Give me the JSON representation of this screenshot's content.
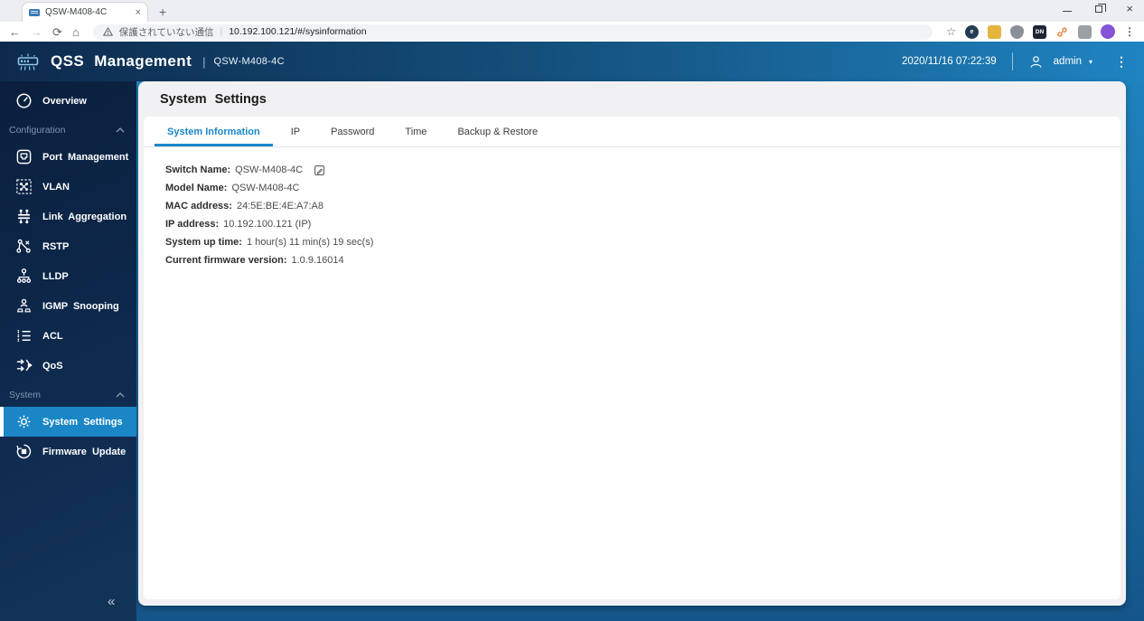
{
  "browser": {
    "tab_title": "QSW-M408-4C",
    "security_warning": "保護されていない通信",
    "url": "10.192.100.121/#/sysinformation",
    "icons": {
      "tab_close": "×",
      "new_tab": "+",
      "back": "←",
      "forward": "→",
      "reload": "⟳",
      "home": "⌂",
      "bookmark_star": "☆",
      "menu_dots": "⋮",
      "window_close": "×"
    },
    "extension_badges": {
      "first": "e",
      "fourth": "DN",
      "link": "🖇"
    }
  },
  "header": {
    "app_title": "QSS Management",
    "divider": "|",
    "device_name": "QSW-M408-4C",
    "datetime": "2020/11/16  07:22:39",
    "user": "admin",
    "user_caret": "▾",
    "menu_dots": "⋮"
  },
  "sidebar": {
    "sections": [
      {
        "label": "Configuration"
      },
      {
        "label": "System"
      }
    ],
    "items": [
      {
        "label": "Overview",
        "icon": "gauge-icon"
      },
      {
        "label": "Port Management",
        "icon": "port-icon"
      },
      {
        "label": "VLAN",
        "icon": "vlan-icon"
      },
      {
        "label": "Link Aggregation",
        "icon": "link-aggregation-icon"
      },
      {
        "label": "RSTP",
        "icon": "rstp-icon"
      },
      {
        "label": "LLDP",
        "icon": "lldp-icon"
      },
      {
        "label": "IGMP Snooping",
        "icon": "igmp-snooping-icon"
      },
      {
        "label": "ACL",
        "icon": "acl-icon"
      },
      {
        "label": "QoS",
        "icon": "qos-icon"
      },
      {
        "label": "System Settings",
        "icon": "gear-icon",
        "active": true
      },
      {
        "label": "Firmware Update",
        "icon": "firmware-update-icon"
      }
    ],
    "collapse_icon": "«"
  },
  "main": {
    "title": "System Settings",
    "tabs": [
      {
        "label": "System Information",
        "active": true
      },
      {
        "label": "IP"
      },
      {
        "label": "Password"
      },
      {
        "label": "Time"
      },
      {
        "label": "Backup & Restore"
      }
    ],
    "fields": [
      {
        "label": "Switch Name:",
        "value": "QSW-M408-4C"
      },
      {
        "label": "Model Name:",
        "value": "QSW-M408-4C"
      },
      {
        "label": "MAC address:",
        "value": "24:5E:BE:4E:A7:A8"
      },
      {
        "label": "IP address:",
        "value": "10.192.100.121 (IP)"
      },
      {
        "label": "System up time:",
        "value": "1 hour(s) 11 min(s) 19 sec(s)"
      },
      {
        "label": "Current firmware version:",
        "value": "1.0.9.16014"
      }
    ]
  },
  "colors": {
    "accent_blue": "#1a86c5",
    "header_gradient_start": "#0d2a4c",
    "header_gradient_end": "#1f84c2",
    "sidebar_navy": "#0a1f3d",
    "card_gray": "#f1f1f3"
  }
}
